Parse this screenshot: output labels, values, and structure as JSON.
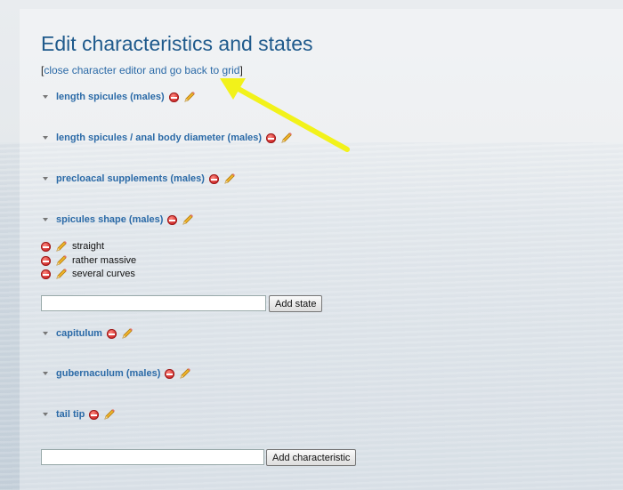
{
  "page": {
    "title": "Edit characteristics and states",
    "back_prefix": "[",
    "back_link": "close character editor and go back to grid",
    "back_suffix": "]"
  },
  "characteristics": [
    {
      "label": "length spicules (males)"
    },
    {
      "label": "length spicules / anal body diameter (males)"
    },
    {
      "label": "precloacal supplements (males)"
    },
    {
      "label": "spicules shape (males)"
    },
    {
      "label": "capitulum"
    },
    {
      "label": "gubernaculum (males)"
    },
    {
      "label": "tail tip"
    }
  ],
  "states": [
    {
      "label": "straight"
    },
    {
      "label": "rather massive"
    },
    {
      "label": "several curves"
    }
  ],
  "add_state": {
    "value": "",
    "button_label": "Add state"
  },
  "add_characteristic": {
    "value": "",
    "button_label": "Add characteristic"
  },
  "icons": {
    "delete": "remove-icon",
    "edit": "pencil-icon",
    "toggle": "collapse-triangle-icon"
  },
  "colors": {
    "link": "#2b6aa7",
    "title": "#1f5a8c",
    "annotation_arrow": "#f2f21a"
  }
}
